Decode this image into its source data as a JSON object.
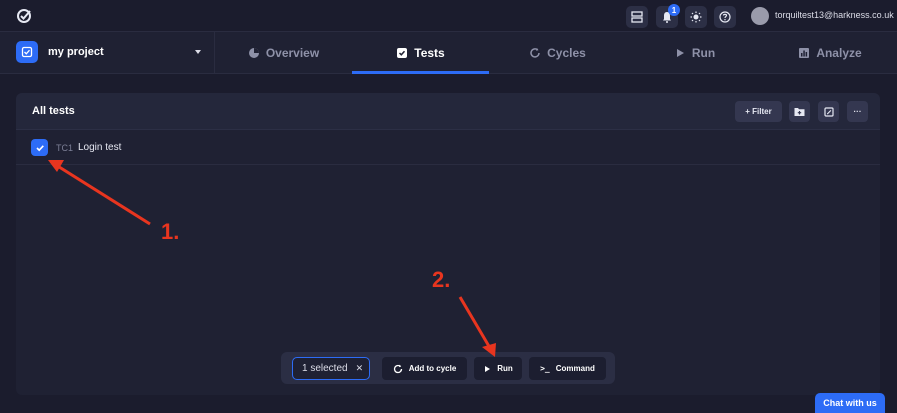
{
  "header": {
    "notification_count": "1",
    "user_email": "torquiltest13@harkness.co.uk"
  },
  "project": {
    "name": "my project"
  },
  "tabs": [
    {
      "label": "Overview",
      "active": false
    },
    {
      "label": "Tests",
      "active": true
    },
    {
      "label": "Cycles",
      "active": false
    },
    {
      "label": "Run",
      "active": false
    },
    {
      "label": "Analyze",
      "active": false
    }
  ],
  "panel": {
    "title": "All tests",
    "filter_label": "+ Filter",
    "more_label": "···"
  },
  "tests": [
    {
      "id": "TC1",
      "name": "Login test",
      "checked": true
    }
  ],
  "action_bar": {
    "selected_label": "1 selected",
    "clear_label": "✕",
    "add_to_cycle_label": "Add to cycle",
    "run_label": "Run",
    "command_label": "Command"
  },
  "chat_label": "Chat with us",
  "annotations": {
    "step1": "1.",
    "step2": "2."
  },
  "colors": {
    "accent": "#2d6cf6",
    "annotation": "#e8351f",
    "background": "#1b1c2d"
  }
}
